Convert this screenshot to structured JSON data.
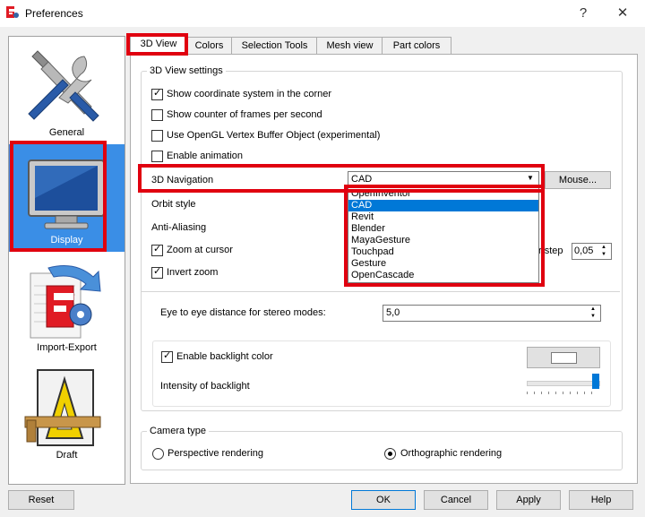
{
  "window": {
    "title": "Preferences",
    "help_glyph": "?",
    "close_glyph": "✕"
  },
  "categories": [
    {
      "label": "General",
      "icon": "tools-icon"
    },
    {
      "label": "Display",
      "icon": "monitor-icon"
    },
    {
      "label": "Import-Export",
      "icon": "import-export-icon"
    },
    {
      "label": "Draft",
      "icon": "draft-icon"
    }
  ],
  "tabs": [
    "3D View",
    "Colors",
    "Selection Tools",
    "Mesh view",
    "Part colors"
  ],
  "view_settings": {
    "title": "3D View settings",
    "checkboxes": [
      {
        "label": "Show coordinate system in the corner",
        "checked": true
      },
      {
        "label": "Show counter of frames per second",
        "checked": false
      },
      {
        "label": "Use OpenGL Vertex Buffer Object (experimental)",
        "checked": false
      },
      {
        "label": "Enable animation",
        "checked": false
      }
    ],
    "navigation_label": "3D Navigation",
    "navigation_value": "CAD",
    "mouse_button": "Mouse...",
    "navigation_options": [
      "OpenInventor",
      "CAD",
      "Revit",
      "Blender",
      "MayaGesture",
      "Touchpad",
      "Gesture",
      "OpenCascade"
    ],
    "orbit_style_label": "Orbit style",
    "anti_aliasing_label": "Anti-Aliasing",
    "zoom_at_cursor": "Zoom at cursor",
    "zoom_step_label": "r step",
    "zoom_step_value": "0,05",
    "invert_zoom": "Invert zoom",
    "eye_distance_label": "Eye to eye distance for stereo modes:",
    "eye_distance_value": "5,0",
    "backlight_label": "Enable backlight color",
    "intensity_label": "Intensity of backlight"
  },
  "camera": {
    "title": "Camera type",
    "perspective": "Perspective rendering",
    "orthographic": "Orthographic rendering",
    "selected": "orthographic"
  },
  "buttons": {
    "reset": "Reset",
    "ok": "OK",
    "cancel": "Cancel",
    "apply": "Apply",
    "help": "Help"
  },
  "colors": {
    "highlight_red": "#e0000f",
    "selection_blue": "#0078d7",
    "category_selected": "#3a8ee6"
  }
}
